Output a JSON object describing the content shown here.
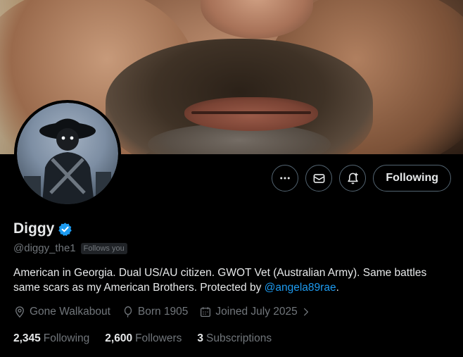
{
  "profile": {
    "name": "Diggy",
    "handle": "@diggy_the1",
    "follows_you": "Follows you",
    "bio_text": "American in Georgia. Dual US/AU citizen. GWOT Vet (Australian Army). Same battles same scars as my American Brothers. Protected by ",
    "bio_mention": "@angela89rae",
    "bio_end": ".",
    "location": "Gone Walkabout",
    "born": "Born 1905",
    "joined": "Joined July 2025"
  },
  "actions": {
    "more_icon": "more-icon",
    "message_icon": "message-icon",
    "notify_icon": "notify-bell-icon",
    "follow_label": "Following"
  },
  "stats": {
    "following_count": "2,345",
    "following_label": "Following",
    "followers_count": "2,600",
    "followers_label": "Followers",
    "subscriptions_count": "3",
    "subscriptions_label": "Subscriptions"
  },
  "colors": {
    "accent": "#1d9bf0",
    "background": "#000000",
    "muted_text": "#71767b",
    "text": "#e7e9ea",
    "button_border": "#536471"
  }
}
